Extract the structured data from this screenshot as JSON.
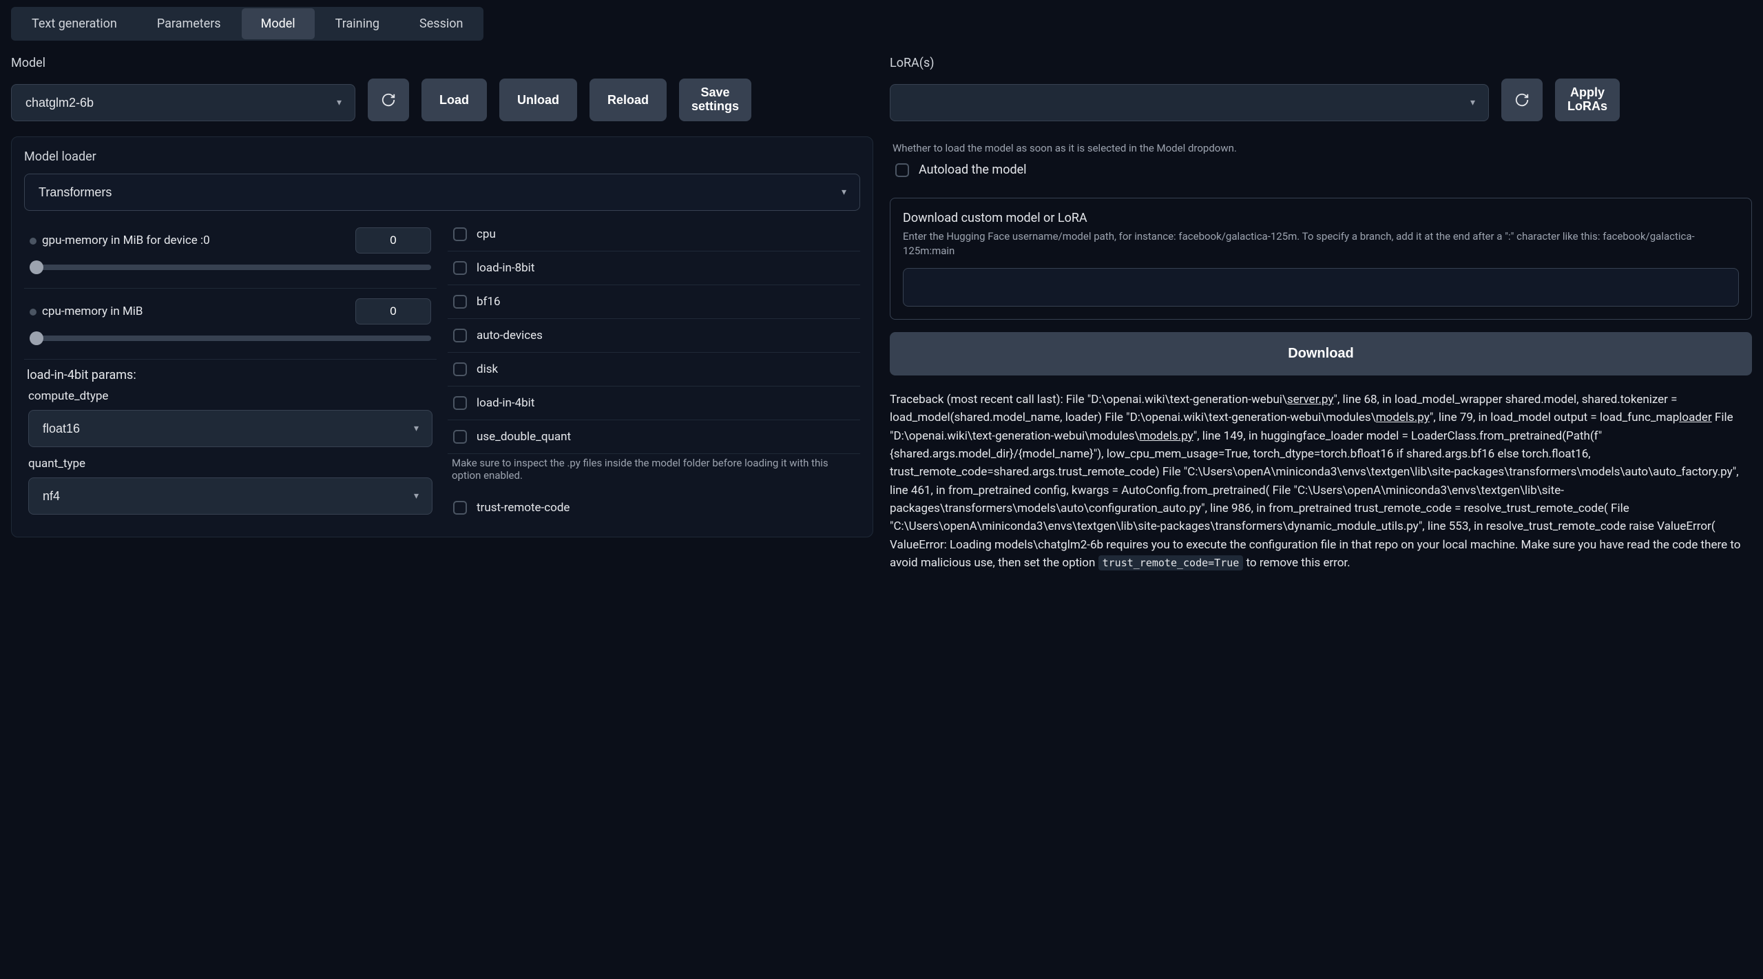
{
  "tabs": [
    "Text generation",
    "Parameters",
    "Model",
    "Training",
    "Session"
  ],
  "active_tab": 2,
  "left": {
    "model_label": "Model",
    "model_value": "chatglm2-6b",
    "load": "Load",
    "unload": "Unload",
    "reload": "Reload",
    "save_settings": "Save settings",
    "loader_panel": "Model loader",
    "loader_value": "Transformers",
    "gpu_mem_label": "gpu-memory in MiB for device :0",
    "gpu_mem_value": "0",
    "cpu_mem_label": "cpu-memory in MiB",
    "cpu_mem_value": "0",
    "load4_section": "load-in-4bit params:",
    "compute_dtype_label": "compute_dtype",
    "compute_dtype_value": "float16",
    "quant_type_label": "quant_type",
    "quant_type_value": "nf4",
    "checks": {
      "cpu": "cpu",
      "load8": "load-in-8bit",
      "bf16": "bf16",
      "autodev": "auto-devices",
      "disk": "disk",
      "load4": "load-in-4bit",
      "dquant": "use_double_quant",
      "trust_help": "Make sure to inspect the .py files inside the model folder before loading it with this option enabled.",
      "trust": "trust-remote-code"
    }
  },
  "right": {
    "lora_label": "LoRA(s)",
    "lora_value": "",
    "apply_loras": "Apply LoRAs",
    "autoload_hint": "Whether to load the model as soon as it is selected in the Model dropdown.",
    "autoload_label": "Autoload the model",
    "dl_title": "Download custom model or LoRA",
    "dl_hint": "Enter the Hugging Face username/model path, for instance: facebook/galactica-125m. To specify a branch, add it at the end after a \":\" character like this: facebook/galactica-125m:main",
    "dl_input": "",
    "download_btn": "Download",
    "trace": {
      "t1": "Traceback (most recent call last): File \"D:\\openai.wiki\\text-generation-webui\\",
      "s1": "server.py",
      "t2": "\", line 68, in load_model_wrapper shared.model, shared.tokenizer = load_model(shared.model_name, loader) File \"D:\\openai.wiki\\text-generation-webui\\modules\\",
      "s2": "models.py",
      "t3": "\", line 79, in load_model output = load_func_map",
      "s3": "loader",
      "t4": " File \"D:\\openai.wiki\\text-generation-webui\\modules\\",
      "s4": "models.py",
      "t5": "\", line 149, in huggingface_loader model = LoaderClass.from_pretrained(Path(f\"{shared.args.model_dir}/{model_name}\"), low_cpu_mem_usage=True, torch_dtype=torch.bfloat16 if shared.args.bf16 else torch.float16, trust_remote_code=shared.args.trust_remote_code) File \"C:\\Users\\openA\\miniconda3\\envs\\textgen\\lib\\site-packages\\transformers\\models\\auto\\auto_factory.py\", line 461, in from_pretrained config, kwargs = AutoConfig.from_pretrained( File \"C:\\Users\\openA\\miniconda3\\envs\\textgen\\lib\\site-packages\\transformers\\models\\auto\\configuration_auto.py\", line 986, in from_pretrained trust_remote_code = resolve_trust_remote_code( File \"C:\\Users\\openA\\miniconda3\\envs\\textgen\\lib\\site-packages\\transformers\\dynamic_module_utils.py\", line 553, in resolve_trust_remote_code raise ValueError( ValueError: Loading models\\chatglm2-6b requires you to execute the configuration file in that repo on your local machine. Make sure you have read the code there to avoid malicious use, then set the option ",
      "code": "trust_remote_code=True",
      "t6": " to remove this error."
    }
  }
}
